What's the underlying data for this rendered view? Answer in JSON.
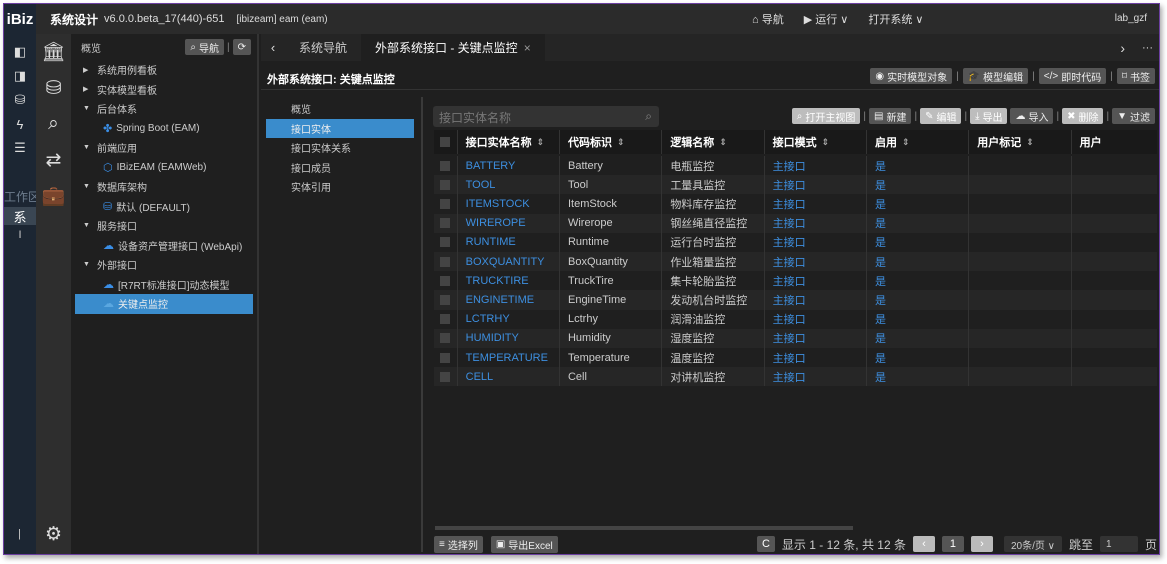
{
  "app": {
    "logo": "iBiz",
    "title": "系统设计",
    "version": "v6.0.0.beta_17(440)-651",
    "project": "[ibizeam] eam (eam)",
    "nav": [
      {
        "icon": "home-icon",
        "label": "导航"
      },
      {
        "icon": "play-icon",
        "label": "运行 ∨"
      },
      {
        "icon": "",
        "label": "打开系统 ∨"
      }
    ],
    "user": "lab_gzf"
  },
  "strip1": {
    "icons": [
      "dashboard-icon",
      "board-icon",
      "database-icon",
      "bolt-icon",
      "server-icon"
    ],
    "workspace_label": "工作区",
    "sys_label": "系",
    "bar_label": "I"
  },
  "strip2": {
    "icons": [
      "bank-icon",
      "database-icon",
      "search-icon",
      "retweet-icon",
      "briefcase-icon"
    ],
    "settings_icon": "gear-icon"
  },
  "tree": {
    "header": "概览",
    "nav_btn": "导航",
    "nodes": [
      {
        "label": "系统用例看板",
        "level": 0,
        "caret": "▶"
      },
      {
        "label": "实体模型看板",
        "level": 0,
        "caret": "▶"
      },
      {
        "label": "后台体系",
        "level": 0,
        "caret": "▼"
      },
      {
        "label": "Spring Boot (EAM)",
        "level": 1,
        "icon": "✤"
      },
      {
        "label": "前端应用",
        "level": 0,
        "caret": "▼"
      },
      {
        "label": "IBizEAM (EAMWeb)",
        "level": 1,
        "icon": "⬡"
      },
      {
        "label": "数据库架构",
        "level": 0,
        "caret": "▼"
      },
      {
        "label": "默认 (DEFAULT)",
        "level": 1,
        "icon": "⛁"
      },
      {
        "label": "服务接口",
        "level": 0,
        "caret": "▼"
      },
      {
        "label": "设备资产管理接口 (WebApi)",
        "level": 1,
        "icon": "☁"
      },
      {
        "label": "外部接口",
        "level": 0,
        "caret": "▼"
      },
      {
        "label": "[R7RT标准接口]动态模型",
        "level": 1,
        "icon": "☁"
      },
      {
        "label": "关键点监控",
        "level": 1,
        "icon": "☁",
        "selected": true
      }
    ]
  },
  "tabs": [
    {
      "label": "系统导航"
    },
    {
      "label": "外部系统接口 - 关键点监控",
      "active": true
    }
  ],
  "content": {
    "title": "外部系统接口: 关键点监控",
    "toolbar": [
      "实时模型对象",
      "模型编辑",
      "即时代码",
      "书签"
    ],
    "subnav": [
      {
        "label": "概览"
      },
      {
        "label": "接口实体",
        "selected": true
      },
      {
        "label": "接口实体关系"
      },
      {
        "label": "接口成员"
      },
      {
        "label": "实体引用"
      }
    ],
    "search_placeholder": "接口实体名称",
    "grid_toolbar": [
      "打开主视图",
      "新建",
      "编辑",
      "导出",
      "导入",
      "删除",
      "过滤"
    ],
    "columns": [
      "接口实体名称",
      "代码标识",
      "逻辑名称",
      "接口模式",
      "启用",
      "用户标记",
      "用户"
    ],
    "rows": [
      [
        "BATTERY",
        "Battery",
        "电瓶监控",
        "主接口",
        "是"
      ],
      [
        "TOOL",
        "Tool",
        "工量具监控",
        "主接口",
        "是"
      ],
      [
        "ITEMSTOCK",
        "ItemStock",
        "物料库存监控",
        "主接口",
        "是"
      ],
      [
        "WIREROPE",
        "Wirerope",
        "钢丝绳直径监控",
        "主接口",
        "是"
      ],
      [
        "RUNTIME",
        "Runtime",
        "运行台时监控",
        "主接口",
        "是"
      ],
      [
        "BOXQUANTITY",
        "BoxQuantity",
        "作业箱量监控",
        "主接口",
        "是"
      ],
      [
        "TRUCKTIRE",
        "TruckTire",
        "集卡轮胎监控",
        "主接口",
        "是"
      ],
      [
        "ENGINETIME",
        "EngineTime",
        "发动机台时监控",
        "主接口",
        "是"
      ],
      [
        "LCTRHY",
        "Lctrhy",
        "润滑油监控",
        "主接口",
        "是"
      ],
      [
        "HUMIDITY",
        "Humidity",
        "湿度监控",
        "主接口",
        "是"
      ],
      [
        "TEMPERATURE",
        "Temperature",
        "温度监控",
        "主接口",
        "是"
      ],
      [
        "CELL",
        "Cell",
        "对讲机监控",
        "主接口",
        "是"
      ]
    ],
    "footer": {
      "select_cols": "选择列",
      "export_excel": "导出Excel",
      "summary": "显示 1 - 12 条, 共 12 条",
      "page": "1",
      "page_size": "20条/页 ∨",
      "jump_label": "跳至",
      "jump_value": "1",
      "page_unit": "页"
    }
  }
}
